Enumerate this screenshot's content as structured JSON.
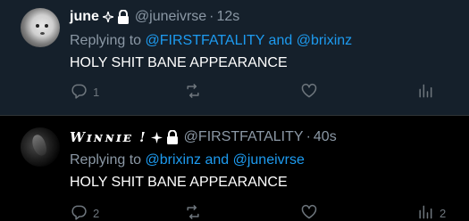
{
  "tweets": [
    {
      "display_name": "june",
      "handle": "@juneivrse",
      "dot": "·",
      "time": "12s",
      "reply_prefix": "Replying to",
      "reply_mention_1": "@FIRSTFATALITY",
      "reply_and": "and",
      "reply_mention_2": "@brixinz",
      "text": "HOLY SHIT BANE APPEARANCE",
      "reply_count": "1",
      "retweet_count": "",
      "like_count": "",
      "view_count": ""
    },
    {
      "display_name": "𝑾ɪɴɴɪᴇ !",
      "handle": "@FIRSTFATALITY",
      "dot": "·",
      "time": "40s",
      "reply_prefix": "Replying to",
      "reply_mention_1": "@brixinz",
      "reply_and": "and",
      "reply_mention_2": "@juneivrse",
      "text": "HOLY SHIT BANE APPEARANCE",
      "reply_count": "2",
      "retweet_count": "",
      "like_count": "",
      "view_count": "2"
    }
  ],
  "colors": {
    "accent": "#1d9bf0",
    "muted": "#8b98a5",
    "highlight_bg": "#15202b"
  }
}
